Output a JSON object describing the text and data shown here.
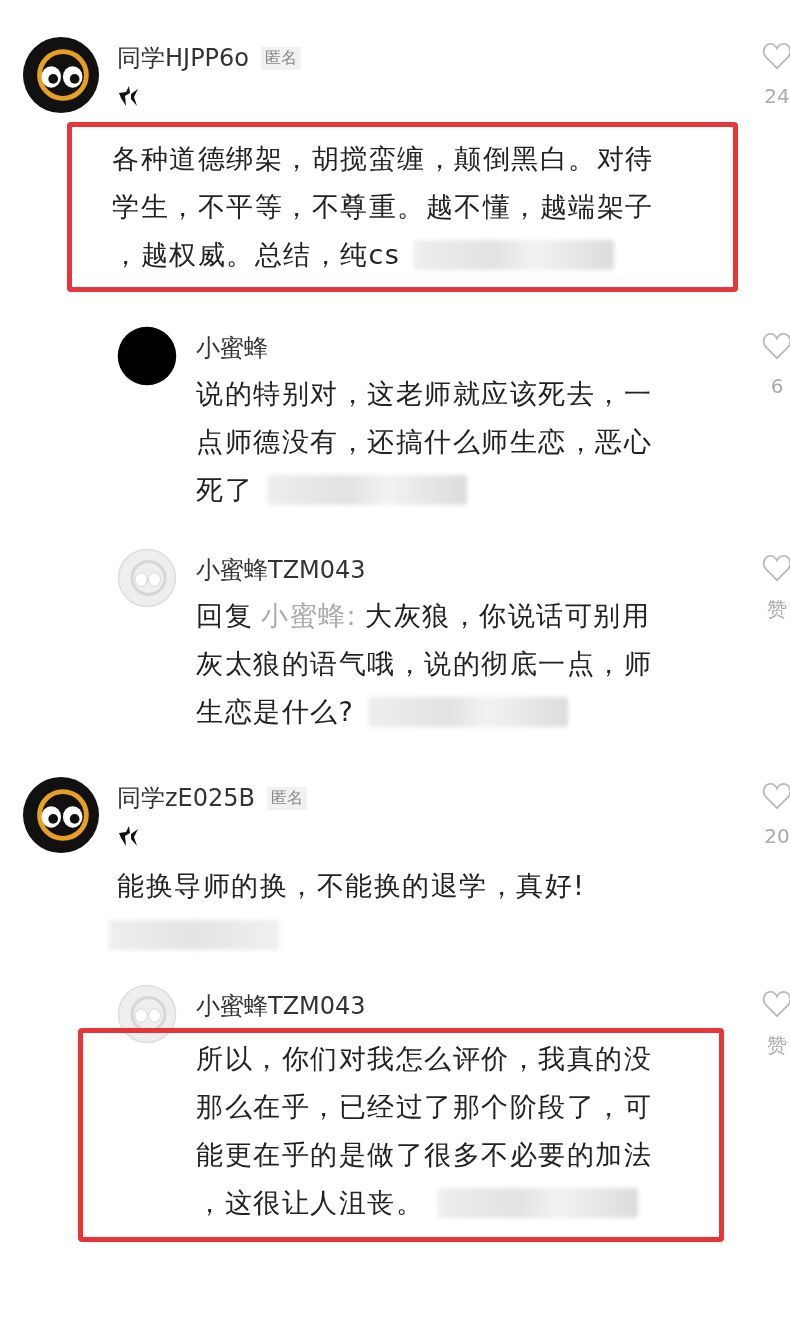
{
  "comments": [
    {
      "avatar": {
        "kind": "mascot"
      },
      "name": "同学HJPP6o",
      "tag": "匿名",
      "badge": true,
      "highlighted": true,
      "lines": [
        "各种道德绑架，胡搅蛮缠，颠倒黑白。对待",
        "学生，不平等，不尊重。越不懂，越端架子",
        "，越权威。总结，纯cs"
      ],
      "blurred": true,
      "likes": "24",
      "replies": [
        {
          "avatar": {
            "kind": "dark"
          },
          "name": "小蜜蜂",
          "highlighted": false,
          "lines": [
            "说的特别对，这老师就应该死去，一",
            "点师德没有，还搞什么师生恋，恶心",
            "死了"
          ],
          "blurred": true,
          "likes": "6"
        },
        {
          "avatar": {
            "kind": "faded"
          },
          "name": "小蜜蜂TZM043",
          "highlighted": false,
          "reply_prefix": "回复",
          "reply_to": "小蜜蜂:",
          "lines": [
            "大灰狼，你说话可别用",
            "灰太狼的语气哦，说的彻底一点，师",
            "生恋是什么?"
          ],
          "blurred": true,
          "likes": "赞"
        }
      ]
    },
    {
      "avatar": {
        "kind": "mascot"
      },
      "name": "同学zE025B",
      "tag": "匿名",
      "badge": true,
      "highlighted": false,
      "lines": [
        "能换导师的换，不能换的退学，真好!"
      ],
      "blurred_footer": true,
      "likes": "20",
      "replies": [
        {
          "avatar": {
            "kind": "faded"
          },
          "name": "小蜜蜂TZM043",
          "highlighted": true,
          "lines": [
            "所以，你们对我怎么评价，我真的没",
            "那么在乎，已经过了那个阶段了，可",
            "能更在乎的是做了很多不必要的加法",
            "，这很让人沮丧。"
          ],
          "blurred": true,
          "likes": "赞"
        }
      ]
    }
  ]
}
